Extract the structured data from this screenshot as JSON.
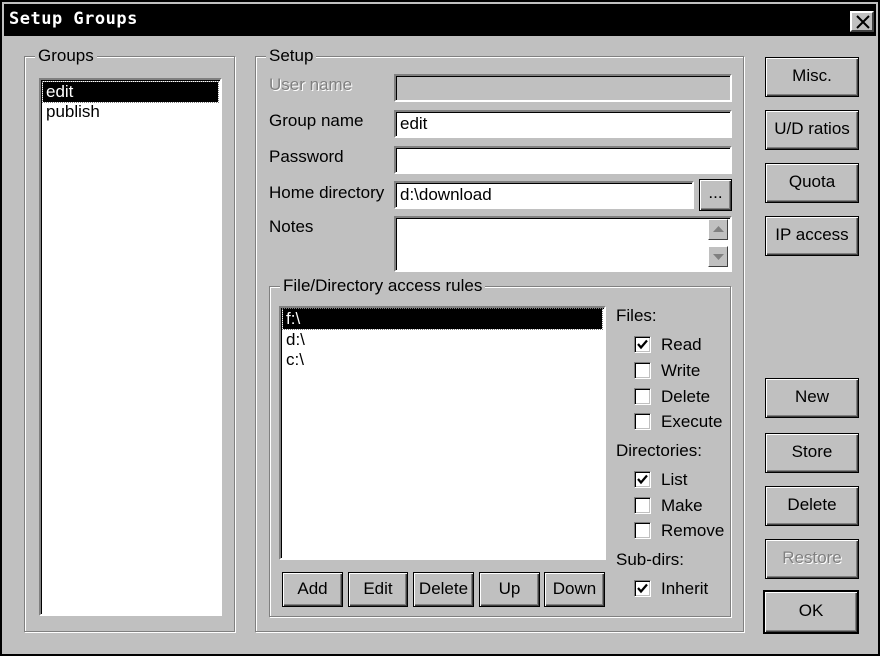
{
  "window": {
    "title": "Setup Groups"
  },
  "icons": {
    "close": "close-icon",
    "scroll_up": "arrow-up-icon",
    "scroll_down": "arrow-down-icon",
    "check": "checkmark-icon"
  },
  "groups": {
    "legend": "Groups",
    "items": [
      {
        "label": "edit",
        "selected": true
      },
      {
        "label": "publish",
        "selected": false
      }
    ]
  },
  "setup": {
    "legend": "Setup",
    "user_name": {
      "label": "User name",
      "value": "",
      "disabled": true
    },
    "group_name": {
      "label": "Group name",
      "value": "edit"
    },
    "password": {
      "label": "Password",
      "value": ""
    },
    "home_directory": {
      "label": "Home directory",
      "value": "d:\\download",
      "browse_label": "..."
    },
    "notes": {
      "label": "Notes",
      "value": ""
    }
  },
  "access_rules": {
    "legend": "File/Directory access rules",
    "items": [
      {
        "label": "f:\\",
        "selected": true
      },
      {
        "label": "d:\\",
        "selected": false
      },
      {
        "label": "c:\\",
        "selected": false
      }
    ],
    "buttons": {
      "add": "Add",
      "edit": "Edit",
      "delete": "Delete",
      "up": "Up",
      "down": "Down"
    }
  },
  "files": {
    "heading": "Files:",
    "read": {
      "label": "Read",
      "checked": true
    },
    "write": {
      "label": "Write",
      "checked": false
    },
    "delete": {
      "label": "Delete",
      "checked": false
    },
    "execute": {
      "label": "Execute",
      "checked": false
    }
  },
  "directories": {
    "heading": "Directories:",
    "list": {
      "label": "List",
      "checked": true
    },
    "make": {
      "label": "Make",
      "checked": false
    },
    "remove": {
      "label": "Remove",
      "checked": false
    }
  },
  "subdirs": {
    "heading": "Sub-dirs:",
    "inherit": {
      "label": "Inherit",
      "checked": true
    }
  },
  "side_buttons": {
    "misc": "Misc.",
    "ud_ratios": "U/D ratios",
    "quota": "Quota",
    "ip_access": "IP access",
    "new": "New",
    "store": "Store",
    "delete": "Delete",
    "restore": {
      "label": "Restore",
      "disabled": true
    },
    "ok": "OK"
  }
}
